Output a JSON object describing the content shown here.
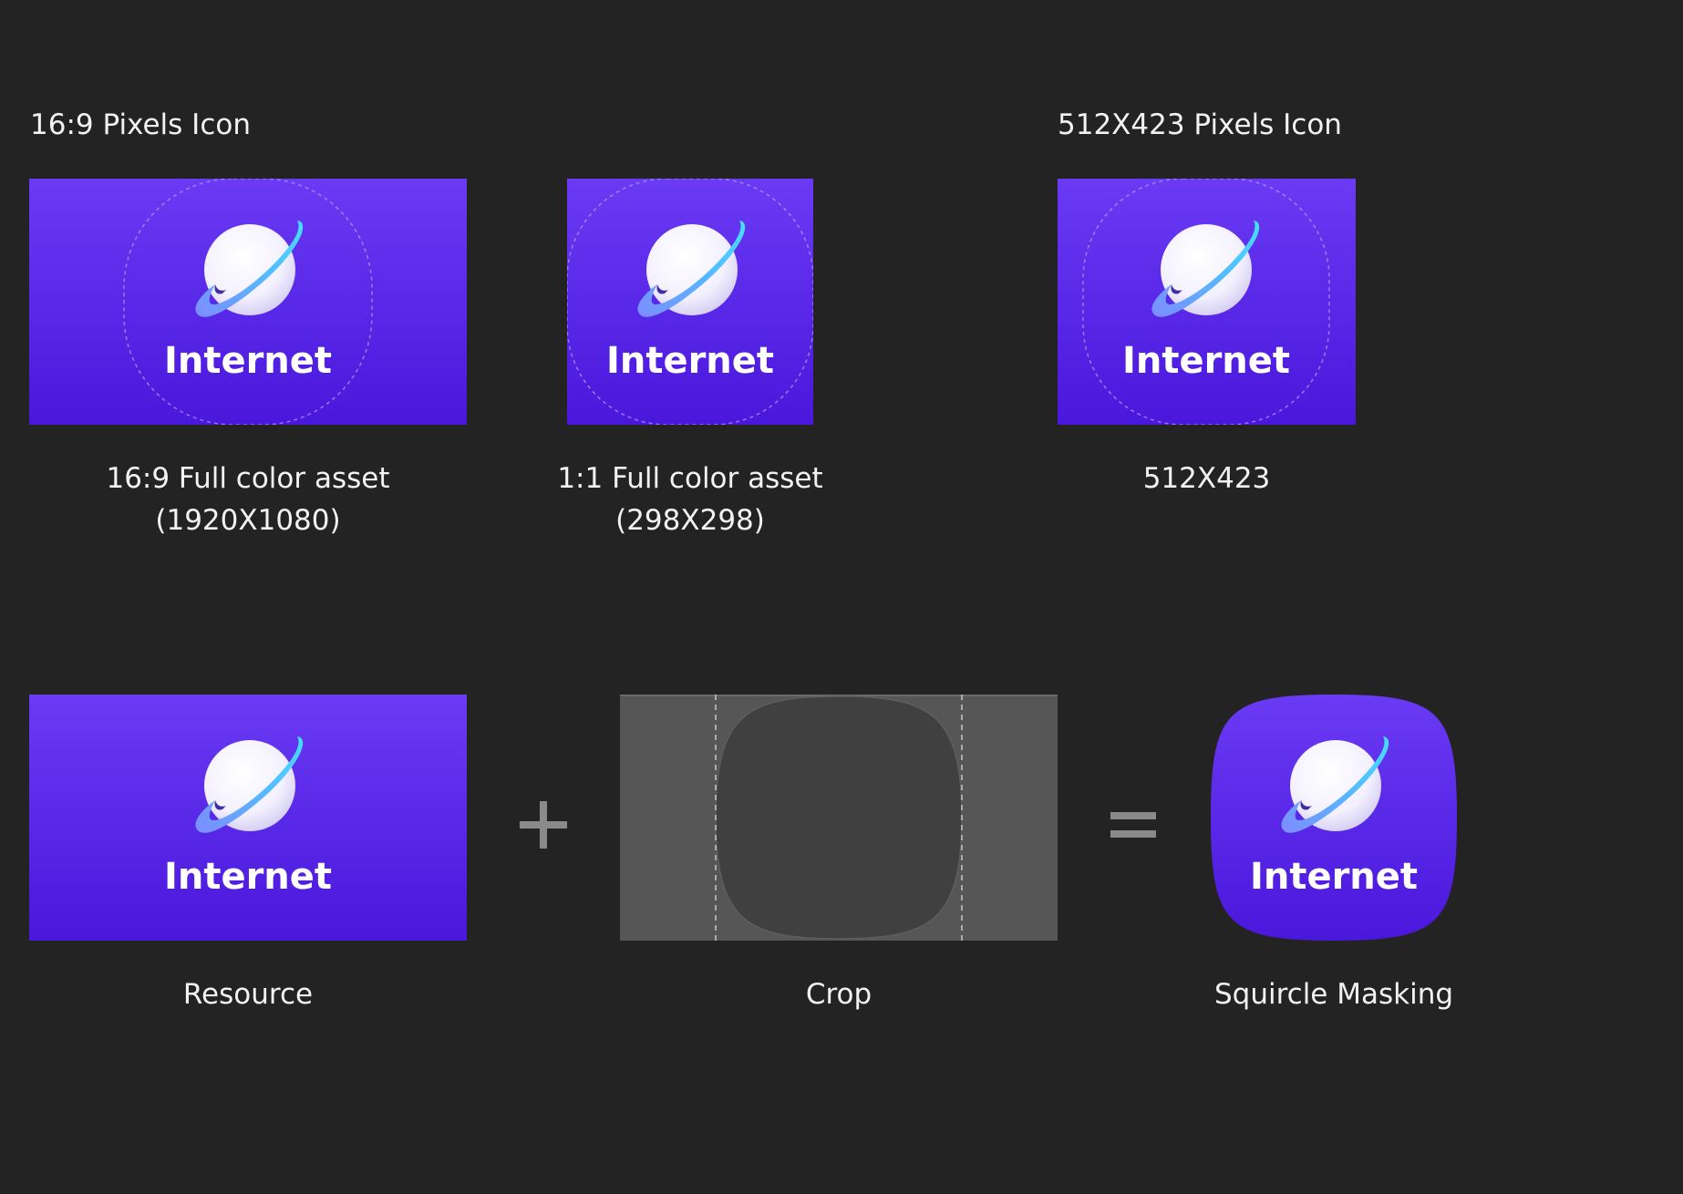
{
  "headings": {
    "left": "16:9 Pixels Icon",
    "right": "512X423 Pixels Icon"
  },
  "top_row": [
    {
      "caption_line1": "16:9 Full color asset",
      "caption_line2": "(1920X1080)",
      "icon_text": "Internet"
    },
    {
      "caption_line1": "1:1 Full color asset",
      "caption_line2": "(298X298)",
      "icon_text": "Internet"
    },
    {
      "caption_line1": "512X423",
      "caption_line2": "",
      "icon_text": "Internet"
    }
  ],
  "bottom_row": {
    "resource": {
      "caption": "Resource",
      "icon_text": "Internet"
    },
    "crop": {
      "caption": "Crop"
    },
    "result": {
      "caption": "Squircle Masking",
      "icon_text": "Internet"
    },
    "plus_symbol": "+",
    "equals_symbol": "="
  },
  "colors": {
    "background": "#232323",
    "tile_top": "#6a3af4",
    "tile_bottom": "#4a17dc",
    "crop_bg": "#565656",
    "crop_shape": "#404040",
    "operator": "#8a8a8a"
  },
  "icon_names": [
    "planet-icon",
    "plus-icon",
    "equals-icon"
  ]
}
